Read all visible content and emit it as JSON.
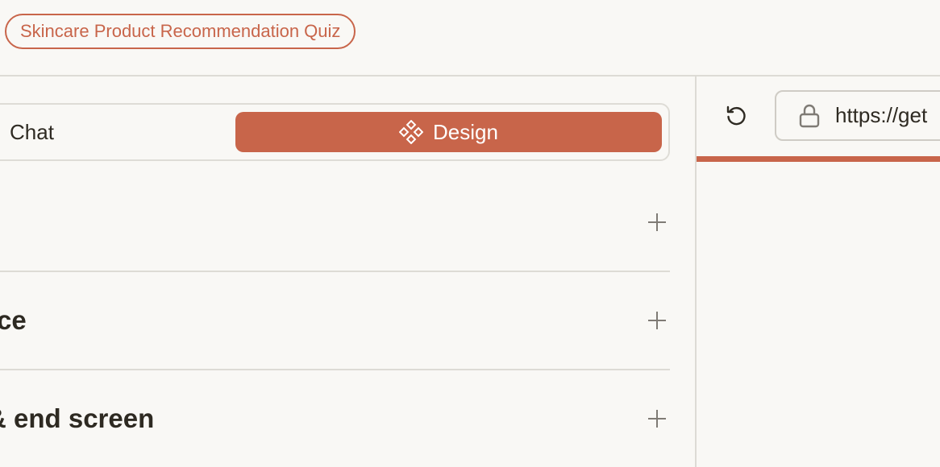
{
  "header": {
    "quiz_title": "Skincare Product Recommendation Quiz"
  },
  "mode_toggle": {
    "chat_label": "Chat",
    "design_label": "Design",
    "active": "Design"
  },
  "sections": [
    {
      "title": ""
    },
    {
      "title": "ce"
    },
    {
      "title": "& end screen"
    }
  ],
  "preview": {
    "url": "https://get"
  },
  "colors": {
    "accent": "#c8654a",
    "background": "#f9f8f5",
    "text": "#2e2a22",
    "border": "#dddbd5",
    "icon": "#7f7b75"
  },
  "icons": {
    "design": "component-diamond-icon",
    "expand": "plus-icon",
    "reload": "reload-icon",
    "lock": "lock-icon"
  }
}
